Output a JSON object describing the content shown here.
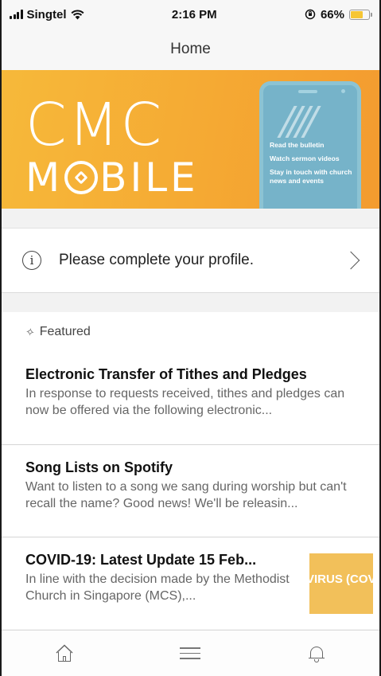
{
  "status_bar": {
    "carrier": "Singtel",
    "time": "2:16 PM",
    "battery_percent": "66%",
    "battery_level": 0.66,
    "battery_color": "#f6c634"
  },
  "nav": {
    "title": "Home"
  },
  "banner": {
    "title": "CMC",
    "subtitle_before_o": "M",
    "subtitle_after_o": "BILE",
    "phone_lines": [
      "Read the bulletin",
      "Watch sermon videos",
      "Stay in touch with church news and events"
    ],
    "accent_color": "#f5a933"
  },
  "profile_prompt": {
    "text": "Please complete your profile.",
    "icon": "info-icon"
  },
  "featured": {
    "label": "Featured",
    "articles": [
      {
        "title": "Electronic Transfer of Tithes and Pledges",
        "excerpt": "In response to requests received, tithes and pledges can now be offered via the following electronic..."
      },
      {
        "title": "Song Lists on Spotify",
        "excerpt": "Want to listen to a song we sang during worship but can't recall the name? Good news! We'll be releasin..."
      },
      {
        "title": "COVID-19: Latest Update 15 Feb...",
        "excerpt": "In line with the decision made by the Methodist Church in Singapore (MCS),...",
        "thumbnail_text": "VIRUS (COV"
      }
    ]
  },
  "tab_bar": {
    "tabs": [
      "home-icon",
      "menu-icon",
      "bell-icon"
    ]
  }
}
